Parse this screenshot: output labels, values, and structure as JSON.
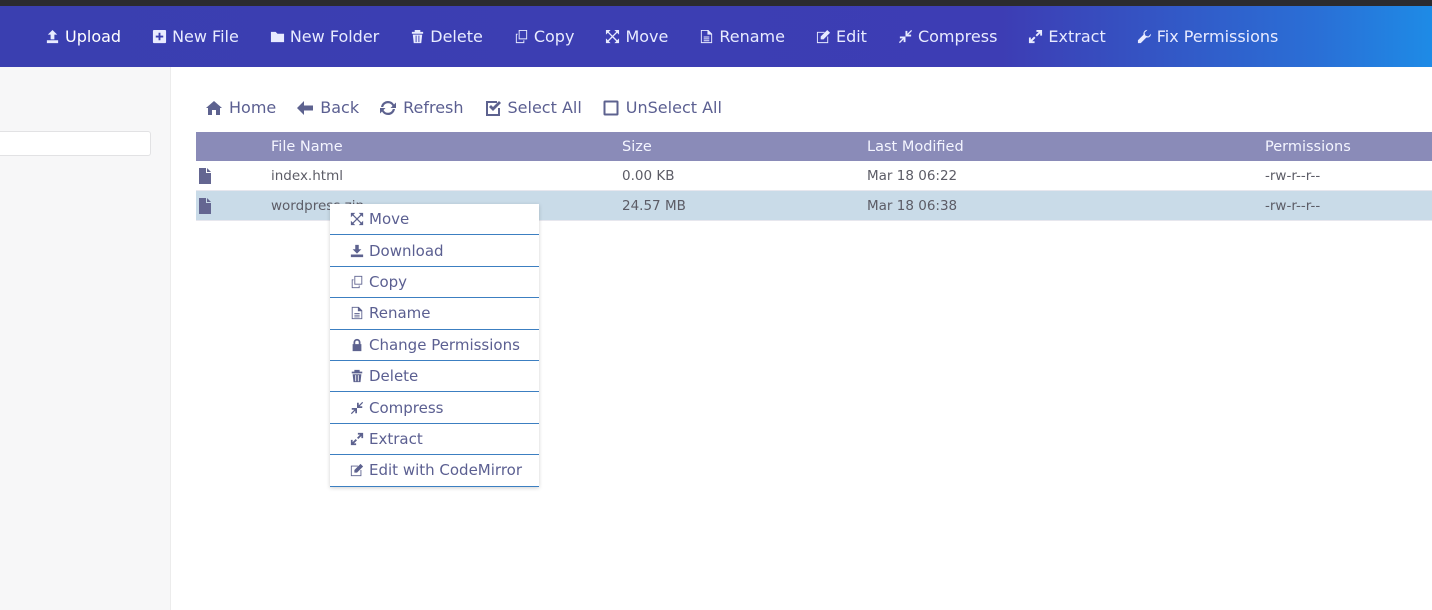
{
  "toolbar": {
    "items": [
      {
        "label": "Upload",
        "icon": "upload-icon"
      },
      {
        "label": "New File",
        "icon": "plus-square-icon"
      },
      {
        "label": "New Folder",
        "icon": "folder-icon"
      },
      {
        "label": "Delete",
        "icon": "trash-icon"
      },
      {
        "label": "Copy",
        "icon": "copy-icon"
      },
      {
        "label": "Move",
        "icon": "move-arrows-icon"
      },
      {
        "label": "Rename",
        "icon": "file-text-icon"
      },
      {
        "label": "Edit",
        "icon": "edit-icon"
      },
      {
        "label": "Compress",
        "icon": "compress-icon"
      },
      {
        "label": "Extract",
        "icon": "expand-icon"
      },
      {
        "label": "Fix Permissions",
        "icon": "wrench-icon"
      }
    ]
  },
  "nav": {
    "home": "Home",
    "back": "Back",
    "refresh": "Refresh",
    "select_all": "Select All",
    "unselect_all": "UnSelect All"
  },
  "table": {
    "headers": {
      "name": "File Name",
      "size": "Size",
      "modified": "Last Modified",
      "permissions": "Permissions"
    },
    "rows": [
      {
        "name": "index.html",
        "size": "0.00 KB",
        "modified": "Mar 18 06:22",
        "permissions": "-rw-r--r--",
        "selected": false
      },
      {
        "name": "wordpress.zip",
        "size": "24.57 MB",
        "modified": "Mar 18 06:38",
        "permissions": "-rw-r--r--",
        "selected": true
      }
    ]
  },
  "context_menu": {
    "items": [
      {
        "label": "Move",
        "icon": "move-arrows-icon"
      },
      {
        "label": "Download",
        "icon": "download-icon"
      },
      {
        "label": "Copy",
        "icon": "copy-icon"
      },
      {
        "label": "Rename",
        "icon": "file-text-icon"
      },
      {
        "label": "Change Permissions",
        "icon": "lock-icon"
      },
      {
        "label": "Delete",
        "icon": "trash-icon"
      },
      {
        "label": "Compress",
        "icon": "compress-icon"
      },
      {
        "label": "Extract",
        "icon": "expand-icon"
      },
      {
        "label": "Edit with CodeMirror",
        "icon": "edit-icon"
      }
    ]
  },
  "colors": {
    "toolbar_start": "#3a3fb0",
    "toolbar_end": "#1e8be6",
    "table_header": "#8a8bb8",
    "selected_row": "#c9dbe8",
    "menu_divider": "#3c7fc1",
    "accent_text": "#5b5f91"
  }
}
